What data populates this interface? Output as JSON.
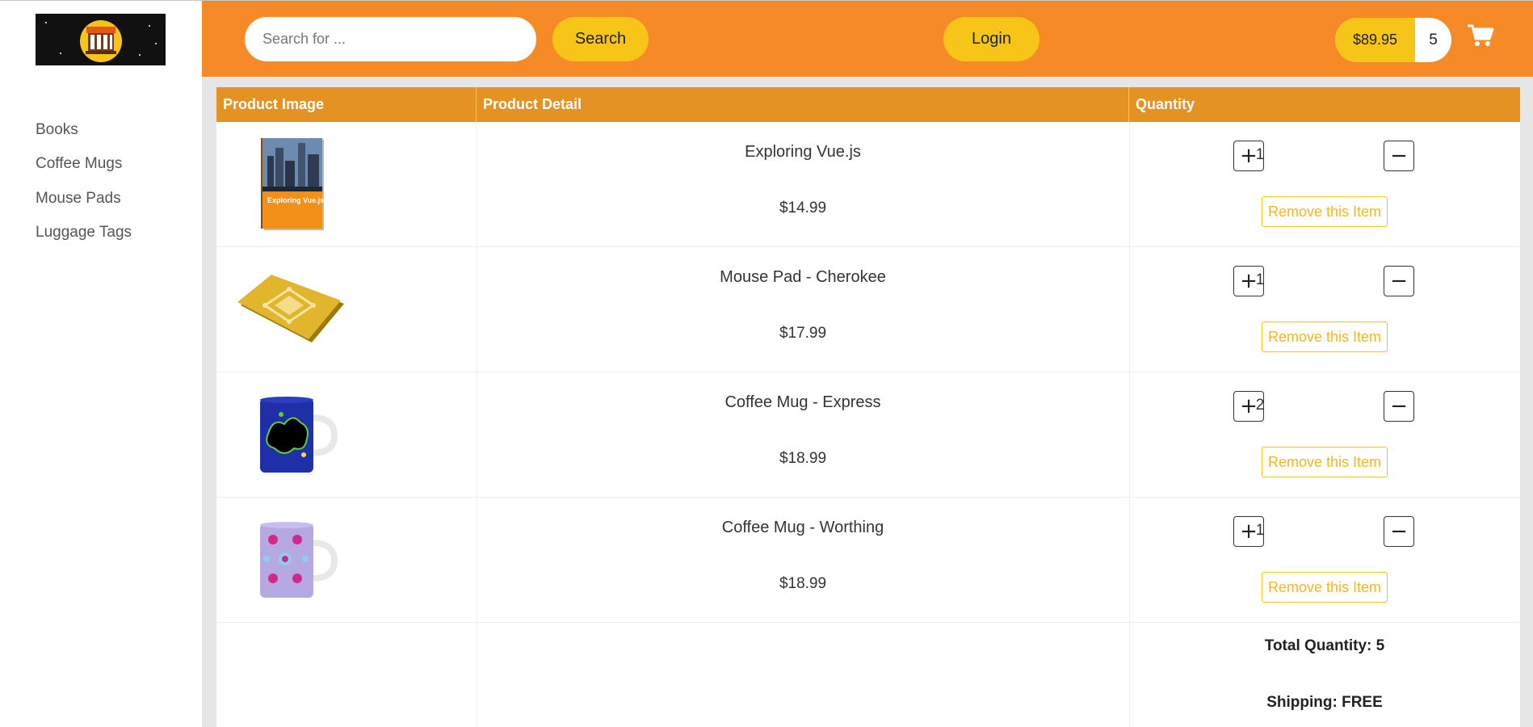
{
  "header": {
    "search_placeholder": "Search for ...",
    "search_label": "Search",
    "login_label": "Login",
    "cart_total": "$89.95",
    "cart_count": "5",
    "logo_icon": "storefront-logo",
    "cart_icon": "shopping-cart-icon"
  },
  "sidebar": {
    "items": [
      {
        "label": "Books"
      },
      {
        "label": "Coffee Mugs"
      },
      {
        "label": "Mouse Pads"
      },
      {
        "label": "Luggage Tags"
      }
    ]
  },
  "table": {
    "headers": [
      "Product Image",
      "Product Detail",
      "Quantity"
    ],
    "rows": [
      {
        "name": "Exploring Vue.js",
        "price": "$14.99",
        "quantity": "1",
        "remove_label": "Remove this Item",
        "image": "book-cover",
        "book_cover_text": "Exploring Vue.js"
      },
      {
        "name": "Mouse Pad - Cherokee",
        "price": "$17.99",
        "quantity": "1",
        "remove_label": "Remove this Item",
        "image": "mouse-pad"
      },
      {
        "name": "Coffee Mug - Express",
        "price": "$18.99",
        "quantity": "2",
        "remove_label": "Remove this Item",
        "image": "coffee-mug-blue"
      },
      {
        "name": "Coffee Mug - Worthing",
        "price": "$18.99",
        "quantity": "1",
        "remove_label": "Remove this Item",
        "image": "coffee-mug-purple"
      }
    ],
    "increment_symbol": "+",
    "decrement_symbol": "−"
  },
  "summary": {
    "total_quantity": "Total Quantity: 5",
    "shipping": "Shipping: FREE"
  },
  "colors": {
    "header_bg": "#f68a26",
    "accent_yellow": "#f7c518",
    "table_header": "#e59224"
  }
}
